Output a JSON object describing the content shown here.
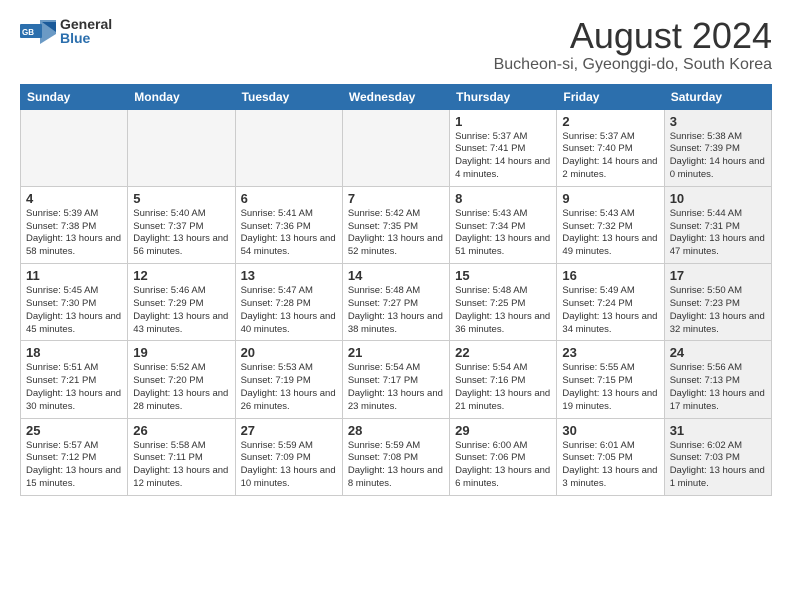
{
  "logo": {
    "general": "General",
    "blue": "Blue"
  },
  "title": "August 2024",
  "location": "Bucheon-si, Gyeonggi-do, South Korea",
  "weekdays": [
    "Sunday",
    "Monday",
    "Tuesday",
    "Wednesday",
    "Thursday",
    "Friday",
    "Saturday"
  ],
  "weeks": [
    [
      {
        "day": "",
        "empty": true
      },
      {
        "day": "",
        "empty": true
      },
      {
        "day": "",
        "empty": true
      },
      {
        "day": "",
        "empty": true
      },
      {
        "day": "1",
        "info": "Sunrise: 5:37 AM\nSunset: 7:41 PM\nDaylight: 14 hours\nand 4 minutes."
      },
      {
        "day": "2",
        "info": "Sunrise: 5:37 AM\nSunset: 7:40 PM\nDaylight: 14 hours\nand 2 minutes."
      },
      {
        "day": "3",
        "shaded": true,
        "info": "Sunrise: 5:38 AM\nSunset: 7:39 PM\nDaylight: 14 hours\nand 0 minutes."
      }
    ],
    [
      {
        "day": "4",
        "info": "Sunrise: 5:39 AM\nSunset: 7:38 PM\nDaylight: 13 hours\nand 58 minutes."
      },
      {
        "day": "5",
        "info": "Sunrise: 5:40 AM\nSunset: 7:37 PM\nDaylight: 13 hours\nand 56 minutes."
      },
      {
        "day": "6",
        "info": "Sunrise: 5:41 AM\nSunset: 7:36 PM\nDaylight: 13 hours\nand 54 minutes."
      },
      {
        "day": "7",
        "info": "Sunrise: 5:42 AM\nSunset: 7:35 PM\nDaylight: 13 hours\nand 52 minutes."
      },
      {
        "day": "8",
        "info": "Sunrise: 5:43 AM\nSunset: 7:34 PM\nDaylight: 13 hours\nand 51 minutes."
      },
      {
        "day": "9",
        "info": "Sunrise: 5:43 AM\nSunset: 7:32 PM\nDaylight: 13 hours\nand 49 minutes."
      },
      {
        "day": "10",
        "shaded": true,
        "info": "Sunrise: 5:44 AM\nSunset: 7:31 PM\nDaylight: 13 hours\nand 47 minutes."
      }
    ],
    [
      {
        "day": "11",
        "info": "Sunrise: 5:45 AM\nSunset: 7:30 PM\nDaylight: 13 hours\nand 45 minutes."
      },
      {
        "day": "12",
        "info": "Sunrise: 5:46 AM\nSunset: 7:29 PM\nDaylight: 13 hours\nand 43 minutes."
      },
      {
        "day": "13",
        "info": "Sunrise: 5:47 AM\nSunset: 7:28 PM\nDaylight: 13 hours\nand 40 minutes."
      },
      {
        "day": "14",
        "info": "Sunrise: 5:48 AM\nSunset: 7:27 PM\nDaylight: 13 hours\nand 38 minutes."
      },
      {
        "day": "15",
        "info": "Sunrise: 5:48 AM\nSunset: 7:25 PM\nDaylight: 13 hours\nand 36 minutes."
      },
      {
        "day": "16",
        "info": "Sunrise: 5:49 AM\nSunset: 7:24 PM\nDaylight: 13 hours\nand 34 minutes."
      },
      {
        "day": "17",
        "shaded": true,
        "info": "Sunrise: 5:50 AM\nSunset: 7:23 PM\nDaylight: 13 hours\nand 32 minutes."
      }
    ],
    [
      {
        "day": "18",
        "info": "Sunrise: 5:51 AM\nSunset: 7:21 PM\nDaylight: 13 hours\nand 30 minutes."
      },
      {
        "day": "19",
        "info": "Sunrise: 5:52 AM\nSunset: 7:20 PM\nDaylight: 13 hours\nand 28 minutes."
      },
      {
        "day": "20",
        "info": "Sunrise: 5:53 AM\nSunset: 7:19 PM\nDaylight: 13 hours\nand 26 minutes."
      },
      {
        "day": "21",
        "info": "Sunrise: 5:54 AM\nSunset: 7:17 PM\nDaylight: 13 hours\nand 23 minutes."
      },
      {
        "day": "22",
        "info": "Sunrise: 5:54 AM\nSunset: 7:16 PM\nDaylight: 13 hours\nand 21 minutes."
      },
      {
        "day": "23",
        "info": "Sunrise: 5:55 AM\nSunset: 7:15 PM\nDaylight: 13 hours\nand 19 minutes."
      },
      {
        "day": "24",
        "shaded": true,
        "info": "Sunrise: 5:56 AM\nSunset: 7:13 PM\nDaylight: 13 hours\nand 17 minutes."
      }
    ],
    [
      {
        "day": "25",
        "info": "Sunrise: 5:57 AM\nSunset: 7:12 PM\nDaylight: 13 hours\nand 15 minutes."
      },
      {
        "day": "26",
        "info": "Sunrise: 5:58 AM\nSunset: 7:11 PM\nDaylight: 13 hours\nand 12 minutes."
      },
      {
        "day": "27",
        "info": "Sunrise: 5:59 AM\nSunset: 7:09 PM\nDaylight: 13 hours\nand 10 minutes."
      },
      {
        "day": "28",
        "info": "Sunrise: 5:59 AM\nSunset: 7:08 PM\nDaylight: 13 hours\nand 8 minutes."
      },
      {
        "day": "29",
        "info": "Sunrise: 6:00 AM\nSunset: 7:06 PM\nDaylight: 13 hours\nand 6 minutes."
      },
      {
        "day": "30",
        "info": "Sunrise: 6:01 AM\nSunset: 7:05 PM\nDaylight: 13 hours\nand 3 minutes."
      },
      {
        "day": "31",
        "shaded": true,
        "info": "Sunrise: 6:02 AM\nSunset: 7:03 PM\nDaylight: 13 hours\nand 1 minute."
      }
    ]
  ]
}
